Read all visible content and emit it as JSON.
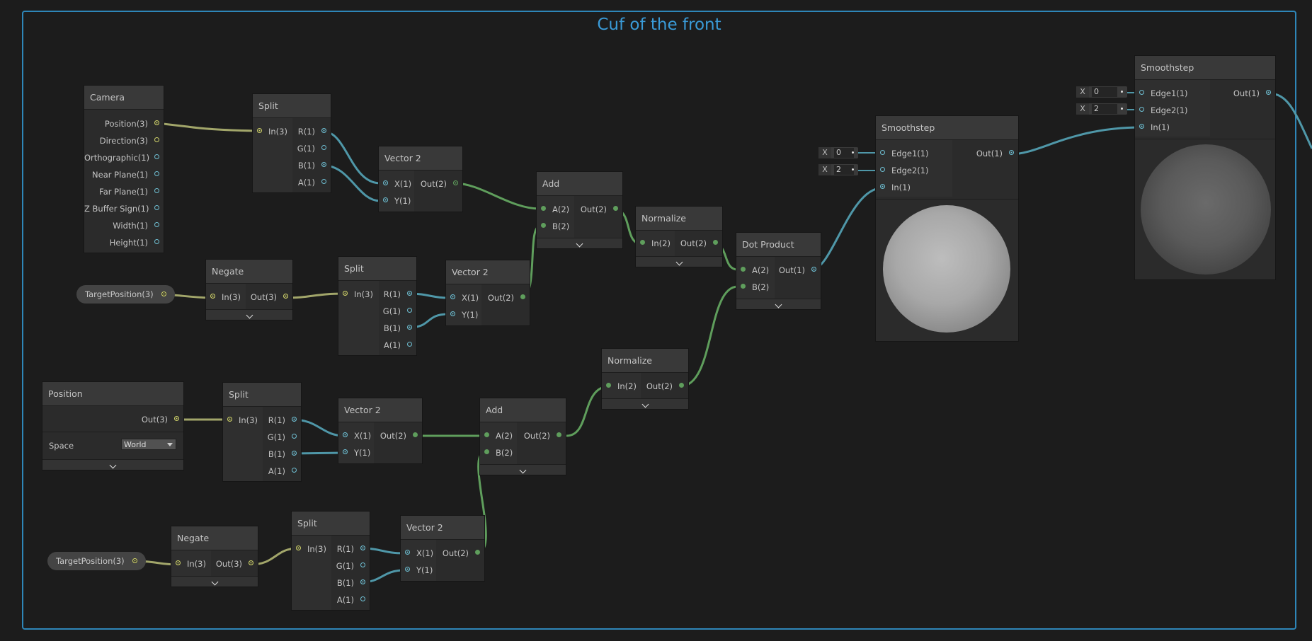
{
  "group_title": "Cuf of the front",
  "nodes": {
    "camera": {
      "title": "Camera",
      "outputs": [
        "Position(3)",
        "Direction(3)",
        "Orthographic(1)",
        "Near Plane(1)",
        "Far Plane(1)",
        "Z Buffer Sign(1)",
        "Width(1)",
        "Height(1)"
      ]
    },
    "split1": {
      "title": "Split",
      "input": "In(3)",
      "outputs": [
        "R(1)",
        "G(1)",
        "B(1)",
        "A(1)"
      ]
    },
    "vector2_1": {
      "title": "Vector 2",
      "inputs": [
        "X(1)",
        "Y(1)"
      ],
      "output": "Out(2)"
    },
    "add1": {
      "title": "Add",
      "inputs": [
        "A(2)",
        "B(2)"
      ],
      "output": "Out(2)"
    },
    "normalize1": {
      "title": "Normalize",
      "input": "In(2)",
      "output": "Out(2)"
    },
    "dot": {
      "title": "Dot Product",
      "inputs": [
        "A(2)",
        "B(2)"
      ],
      "output": "Out(1)"
    },
    "smooth1": {
      "title": "Smoothstep",
      "inputs": [
        "Edge1(1)",
        "Edge2(1)",
        "In(1)"
      ],
      "output": "Out(1)",
      "edge1_axis": "X",
      "edge1_value": "0",
      "edge2_axis": "X",
      "edge2_value": "2"
    },
    "smooth2": {
      "title": "Smoothstep",
      "inputs": [
        "Edge1(1)",
        "Edge2(1)",
        "In(1)"
      ],
      "output": "Out(1)",
      "edge1_axis": "X",
      "edge1_value": "0",
      "edge2_axis": "X",
      "edge2_value": "2"
    },
    "target1": {
      "label": "TargetPosition(3)"
    },
    "negate1": {
      "title": "Negate",
      "input": "In(3)",
      "output": "Out(3)"
    },
    "split2": {
      "title": "Split",
      "input": "In(3)",
      "outputs": [
        "R(1)",
        "G(1)",
        "B(1)",
        "A(1)"
      ]
    },
    "vector2_2": {
      "title": "Vector 2",
      "inputs": [
        "X(1)",
        "Y(1)"
      ],
      "output": "Out(2)"
    },
    "position": {
      "title": "Position",
      "output": "Out(3)",
      "space_label": "Space",
      "space_value": "World"
    },
    "split3": {
      "title": "Split",
      "input": "In(3)",
      "outputs": [
        "R(1)",
        "G(1)",
        "B(1)",
        "A(1)"
      ]
    },
    "vector2_3": {
      "title": "Vector 2",
      "inputs": [
        "X(1)",
        "Y(1)"
      ],
      "output": "Out(2)"
    },
    "add2": {
      "title": "Add",
      "inputs": [
        "A(2)",
        "B(2)"
      ],
      "output": "Out(2)"
    },
    "normalize2": {
      "title": "Normalize",
      "input": "In(2)",
      "output": "Out(2)"
    },
    "target2": {
      "label": "TargetPosition(3)"
    },
    "negate2": {
      "title": "Negate",
      "input": "In(3)",
      "output": "Out(3)"
    },
    "split4": {
      "title": "Split",
      "input": "In(3)",
      "outputs": [
        "R(1)",
        "G(1)",
        "B(1)",
        "A(1)"
      ]
    },
    "vector2_4": {
      "title": "Vector 2",
      "inputs": [
        "X(1)",
        "Y(1)"
      ],
      "output": "Out(2)"
    }
  },
  "colors": {
    "vec3_wire": "#a2a66a",
    "vec2_wire": "#5f9e5c",
    "vec1_wire": "#4f97a8",
    "group_border": "#2e86b8"
  }
}
